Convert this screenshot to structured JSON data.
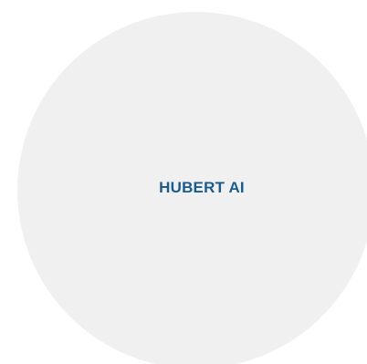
{
  "logo": {
    "text": "HUBERT AI",
    "text_color": "#1a5b8f",
    "background_color": "#f0f0f1"
  }
}
